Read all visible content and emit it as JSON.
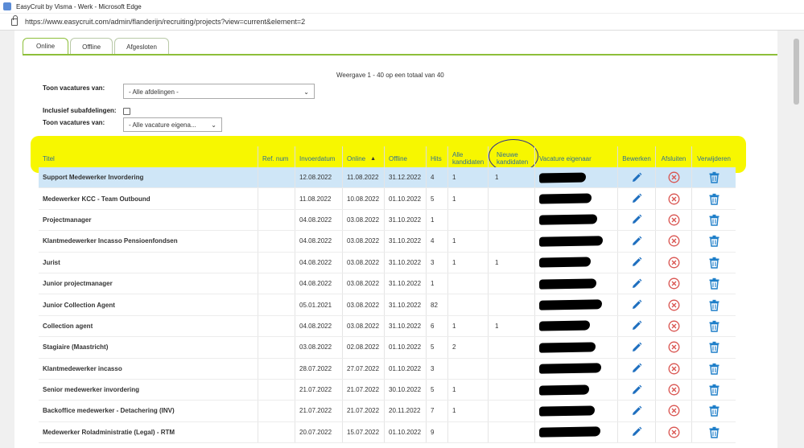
{
  "browser": {
    "window_title": "EasyCruit by Visma - Werk - Microsoft Edge",
    "url": "https://www.easycruit.com/admin/flanderijn/recruiting/projects?view=current&element=2"
  },
  "tabs": [
    {
      "label": "Online",
      "active": true
    },
    {
      "label": "Offline",
      "active": false
    },
    {
      "label": "Afgesloten",
      "active": false
    }
  ],
  "summary": "Weergave 1 - 40 op een totaal van 40",
  "filters": {
    "departments_label": "Toon vacatures van:",
    "departments_value": "- Alle afdelingen -",
    "subdepartments_label": "Inclusief subafdelingen:",
    "owner_label": "Toon vacatures van:",
    "owner_value": "- Alle vacature eigena..."
  },
  "columns": {
    "title": "Titel",
    "ref": "Ref. num",
    "entry": "Invoerdatum",
    "online": "Online",
    "offline": "Offline",
    "hits": "Hits",
    "all_candidates": "Alle kandidaten",
    "new_candidates": "Nieuwe kandidaten",
    "owner": "Vacature eigenaar",
    "edit": "Bewerken",
    "close": "Afsluiten",
    "delete": "Verwijderen"
  },
  "rows": [
    {
      "title": "Support Medewerker Invordering",
      "ref": "",
      "entry": "12.08.2022",
      "online": "11.08.2022",
      "offline": "31.12.2022",
      "hits": "4",
      "all": "1",
      "new": "1"
    },
    {
      "title": "Medewerker KCC - Team Outbound",
      "ref": "",
      "entry": "11.08.2022",
      "online": "10.08.2022",
      "offline": "01.10.2022",
      "hits": "5",
      "all": "1",
      "new": ""
    },
    {
      "title": "Projectmanager",
      "ref": "",
      "entry": "04.08.2022",
      "online": "03.08.2022",
      "offline": "31.10.2022",
      "hits": "1",
      "all": "",
      "new": ""
    },
    {
      "title": "Klantmedewerker Incasso Pensioenfondsen",
      "ref": "",
      "entry": "04.08.2022",
      "online": "03.08.2022",
      "offline": "31.10.2022",
      "hits": "4",
      "all": "1",
      "new": ""
    },
    {
      "title": "Jurist",
      "ref": "",
      "entry": "04.08.2022",
      "online": "03.08.2022",
      "offline": "31.10.2022",
      "hits": "3",
      "all": "1",
      "new": "1"
    },
    {
      "title": "Junior projectmanager",
      "ref": "",
      "entry": "04.08.2022",
      "online": "03.08.2022",
      "offline": "31.10.2022",
      "hits": "1",
      "all": "",
      "new": ""
    },
    {
      "title": "Junior Collection Agent",
      "ref": "",
      "entry": "05.01.2021",
      "online": "03.08.2022",
      "offline": "31.10.2022",
      "hits": "82",
      "all": "",
      "new": ""
    },
    {
      "title": "Collection agent",
      "ref": "",
      "entry": "04.08.2022",
      "online": "03.08.2022",
      "offline": "31.10.2022",
      "hits": "6",
      "all": "1",
      "new": "1"
    },
    {
      "title": "Stagiaire (Maastricht)",
      "ref": "",
      "entry": "03.08.2022",
      "online": "02.08.2022",
      "offline": "01.10.2022",
      "hits": "5",
      "all": "2",
      "new": ""
    },
    {
      "title": "Klantmedewerker incasso",
      "ref": "",
      "entry": "28.07.2022",
      "online": "27.07.2022",
      "offline": "01.10.2022",
      "hits": "3",
      "all": "",
      "new": ""
    },
    {
      "title": "Senior medewerker invordering",
      "ref": "",
      "entry": "21.07.2022",
      "online": "21.07.2022",
      "offline": "30.10.2022",
      "hits": "5",
      "all": "1",
      "new": ""
    },
    {
      "title": "Backoffice medewerker - Detachering (INV)",
      "ref": "",
      "entry": "21.07.2022",
      "online": "21.07.2022",
      "offline": "20.11.2022",
      "hits": "7",
      "all": "1",
      "new": ""
    },
    {
      "title": "Medewerker Roladministratie (Legal) - RTM",
      "ref": "",
      "entry": "20.07.2022",
      "online": "15.07.2022",
      "offline": "01.10.2022",
      "hits": "9",
      "all": "",
      "new": ""
    }
  ],
  "colors": {
    "accent": "#8dbf3a",
    "header_text": "#2f6f93",
    "selected_row": "#cfe6f7",
    "edit_icon": "#1e6fbf",
    "close_icon": "#d9534f",
    "delete_icon": "#1e7fc9",
    "highlight": "#f7f700"
  }
}
